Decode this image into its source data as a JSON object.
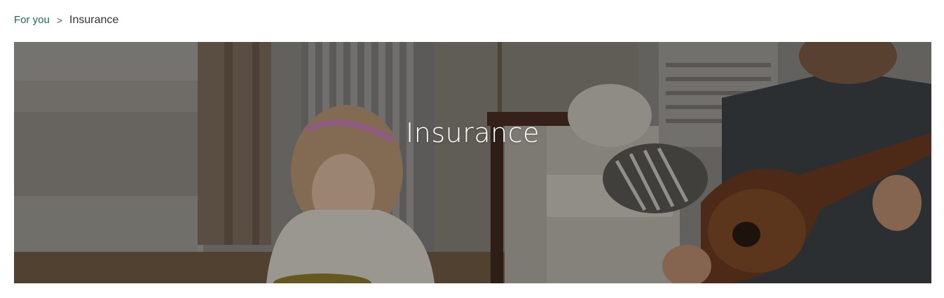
{
  "breadcrumb": {
    "parent_label": "For you",
    "separator": ">",
    "current_label": "Insurance"
  },
  "hero": {
    "title": "Insurance",
    "image_alt": "family-at-home-photo"
  },
  "colors": {
    "link": "#1e6b52",
    "text": "#333333",
    "hero_title": "#ffffff"
  }
}
